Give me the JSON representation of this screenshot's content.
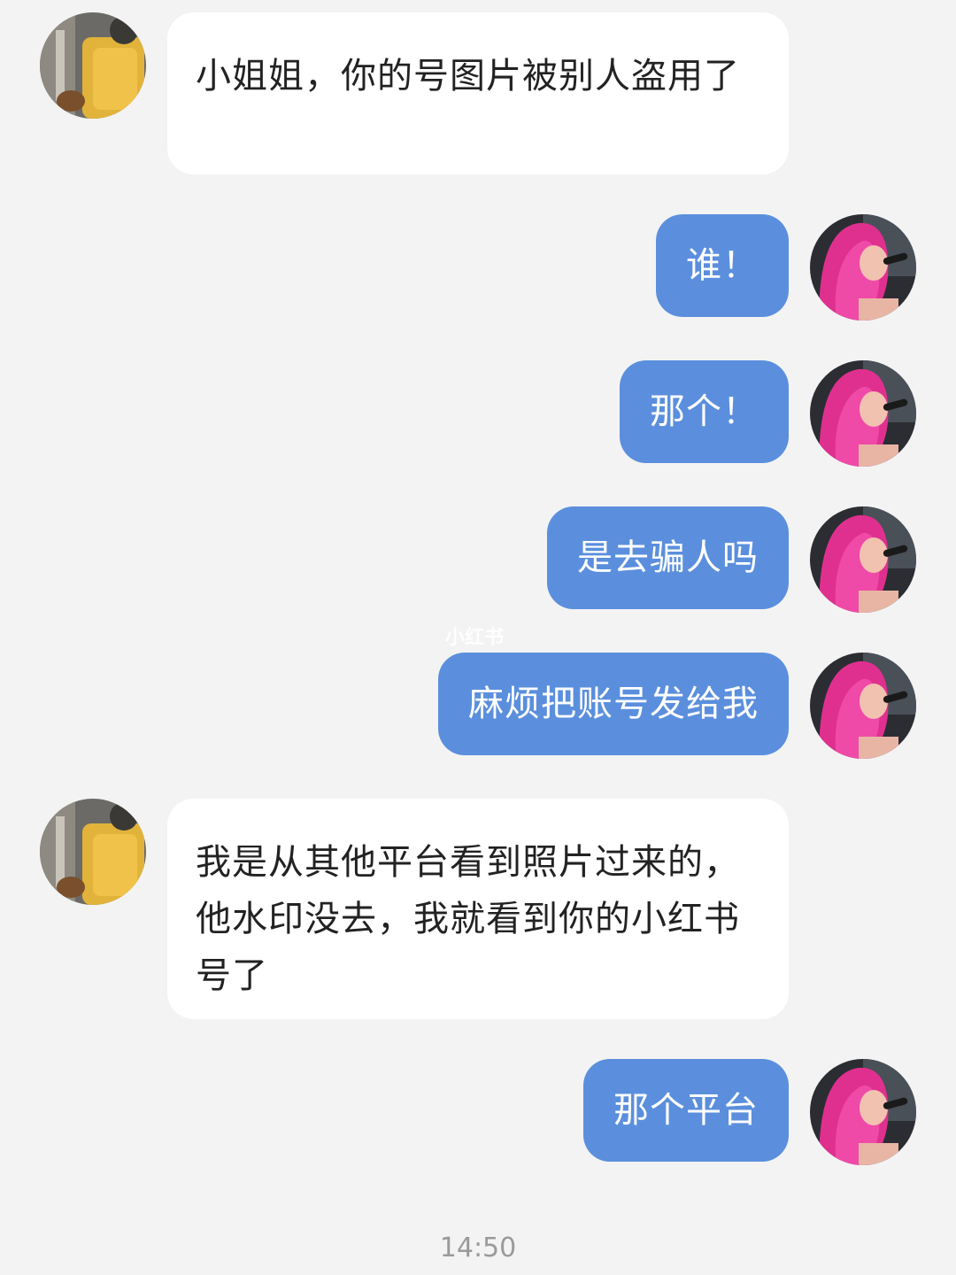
{
  "contact": {
    "avatar_icon": "contact-avatar-yellow-chair-icon"
  },
  "self": {
    "avatar_icon": "self-avatar-pink-hair-singer-icon"
  },
  "messages": [
    {
      "from": "contact",
      "text": "小姐姐，你的号图片被别人盗用了"
    },
    {
      "from": "self",
      "text": "谁！"
    },
    {
      "from": "self",
      "text": "那个！"
    },
    {
      "from": "self",
      "text": "是去骗人吗"
    },
    {
      "from": "self",
      "text": "麻烦把账号发给我"
    },
    {
      "from": "contact",
      "text": "我是从其他平台看到照片过来的，他水印没去，我就看到你的小红书号了"
    },
    {
      "from": "self",
      "text": "那个平台"
    }
  ],
  "watermark": "小红书",
  "timestamp": "14:50",
  "colors": {
    "background": "#f3f3f3",
    "incoming_bubble": "#ffffff",
    "outgoing_bubble": "#5b8fdd",
    "timestamp": "#9a9a9a"
  }
}
